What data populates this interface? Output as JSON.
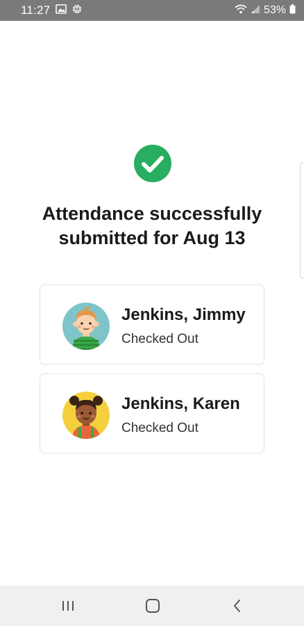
{
  "status_bar": {
    "time": "11:27",
    "battery": "53%",
    "icons": [
      "gallery-icon",
      "basketball-icon",
      "wifi-icon",
      "signal-icon",
      "battery-icon"
    ]
  },
  "confirmation": {
    "icon": "check-circle-icon",
    "color": "#27ae60",
    "line1": "Attendance successfully",
    "line2": "submitted for Aug 13"
  },
  "children": [
    {
      "name": "Jenkins, Jimmy",
      "status": "Checked Out",
      "avatar": "boy-avatar"
    },
    {
      "name": "Jenkins, Karen",
      "status": "Checked Out",
      "avatar": "girl-avatar"
    }
  ],
  "nav_bar": {
    "buttons": [
      "recents-icon",
      "home-icon",
      "back-icon"
    ]
  }
}
